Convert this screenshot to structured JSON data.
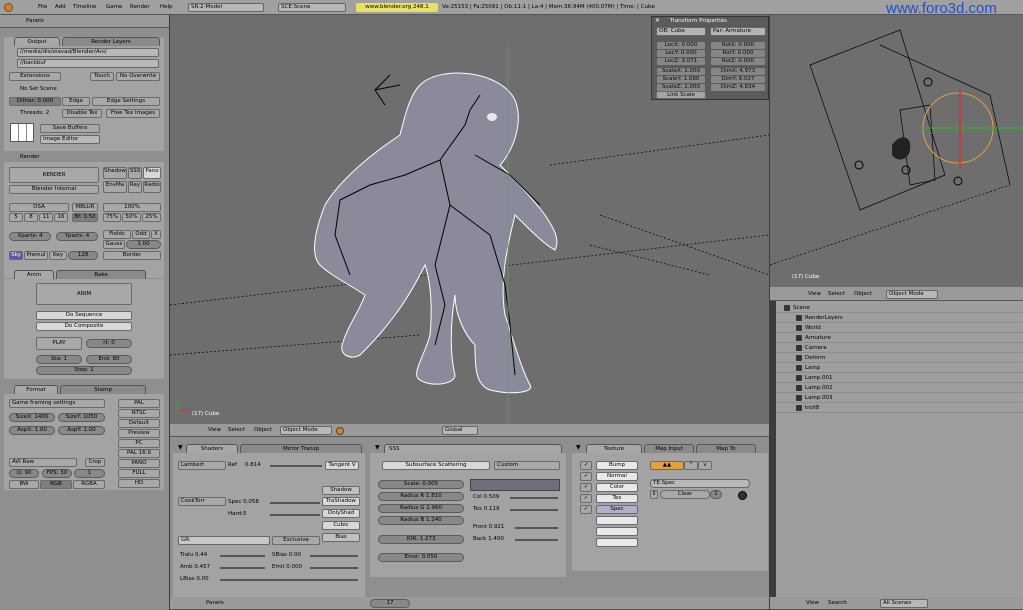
{
  "top_menu": {
    "items": [
      "File",
      "Add",
      "Timeline",
      "Game",
      "Render",
      "Help"
    ],
    "screen": "SR:2-Model",
    "scene": "SCE:Scene",
    "url": "www.blender.org 248.1",
    "stats": "Ve:25153 | Fa:25091 | Ob:11-1 | La:4 | Mem:36.94M (400.07M) | Time: | Cube"
  },
  "watermark": "www.foro3d.com",
  "left": {
    "panels_label": "Panels",
    "output_tab": "Output",
    "renderlayers_tab": "Render Layers",
    "path1": "//media/dis/stavad/Blender/Ani/",
    "path2": "//backbuf",
    "extensions": "Extensions",
    "touch": "Touch",
    "no_overwrite": "No Overwrite",
    "no_set_scene": "No Set Scene",
    "dither": "Dither: 0.000",
    "edge": "Edge",
    "edge_settings": "Edge Settings",
    "threads": "Threads: 2",
    "disable_tex": "Disable Tex",
    "free_tex": "Free Tex Images",
    "save_buffers": "Save Buffers",
    "image_editor": "Image Editor",
    "render_hdr": "Render",
    "render_btn": "RENDER",
    "blender_internal": "Blender Internal",
    "shadow": "Shadow",
    "sss": "SSS",
    "pano": "Pano",
    "envmap": "EnvMa",
    "ray": "Ray",
    "radio": "Radio",
    "osa": "OSA",
    "mblur": "MBLUR",
    "osa_vals": [
      "5",
      "8",
      "11",
      "16"
    ],
    "bf": "Bf: 0.50",
    "pct": [
      "100%",
      "75%",
      "50%",
      "25%"
    ],
    "xparts": "Xparts: 4",
    "yparts": "Yparts: 4",
    "fields": "Fields",
    "odd": "Odd",
    "x": "X",
    "gauss": "Gauss",
    "gauss_val": "1.00",
    "sky": "Sky",
    "premul": "Premul",
    "key": "Key",
    "val128": "128",
    "border": "Border",
    "anim_tab": "Anim",
    "bake_tab": "Bake",
    "anim_btn": "ANIM",
    "do_sequence": "Do Sequence",
    "do_composite": "Do Composite",
    "play": "PLAY",
    "rt": "rt: 0",
    "sta": "Sta: 1",
    "end": "End: 80",
    "step": "Step: 1",
    "format_tab": "Format",
    "stamp_tab": "Stamp",
    "game_framing": "Game framing settings",
    "sizex": "SizeX: 1400",
    "sizey": "SizeY: 1050",
    "aspx": "AspX: 1.00",
    "aspy": "AspY: 1.00",
    "presets": [
      "PAL",
      "NTSC",
      "Default",
      "Preview",
      "PC",
      "PAL 16:9",
      "PANO",
      "FULL",
      "HD"
    ],
    "avi_raw": "AVI Raw",
    "crop": "Crop",
    "q": "Q: 90",
    "fps": "FPS: 30",
    "val1": "1",
    "bw": "BW",
    "rgb": "RGB",
    "rgba": "RGBA"
  },
  "viewport": {
    "label": "(17) Cube",
    "menu": [
      "View",
      "Select",
      "Object"
    ],
    "mode": "Object Mode",
    "global": "Global"
  },
  "transform": {
    "title": "Transform Properties",
    "ob": "OB: Cube",
    "par": "Par: Armature",
    "loc": [
      "LocX: 0.000",
      "LocY: 0.000",
      "LocZ: 3.071"
    ],
    "rot": [
      "RotX: 0.000",
      "RotY: 0.000",
      "RotZ: 0.000"
    ],
    "scale": [
      "ScaleX: 1.000",
      "ScaleY: 1.090",
      "ScaleZ: 1.000"
    ],
    "dim": [
      "DimX: 4.973",
      "DimY: 6.027",
      "DimZ: 4.834"
    ],
    "link_scale": "Link Scale"
  },
  "camview": {
    "label": "(17) Cube",
    "menu": [
      "View",
      "Select",
      "Object"
    ],
    "mode": "Object Mode"
  },
  "outliner": {
    "items": [
      {
        "name": "Scene",
        "indent": 0
      },
      {
        "name": "RenderLayers",
        "indent": 1
      },
      {
        "name": "World",
        "indent": 1
      },
      {
        "name": "Armature",
        "indent": 1
      },
      {
        "name": "Camera",
        "indent": 1
      },
      {
        "name": "Deform",
        "indent": 1
      },
      {
        "name": "Lamp",
        "indent": 1
      },
      {
        "name": "Lamp.001",
        "indent": 1
      },
      {
        "name": "Lamp.002",
        "indent": 1
      },
      {
        "name": "Lamp.003",
        "indent": 1
      },
      {
        "name": "troll8",
        "indent": 1
      }
    ],
    "footer": [
      "View",
      "Search"
    ],
    "all_scenes": "All Scenes"
  },
  "shaders": {
    "tab1": "Shaders",
    "tab2": "Mirror Transp",
    "lambert": "Lambert",
    "ref": "Ref",
    "ref_val": "0.814",
    "tangent": "Tangent V",
    "cooktorr": "CookTorr",
    "spec": "Spec 0.058",
    "hard": "Hard:5",
    "shadow": "Shadow",
    "trashadow": "TraShadow",
    "onlyshad": "OnlyShad",
    "cubic": "Cubic",
    "bias": "Bias",
    "gr": "GR:",
    "exclusive": "Exclusive",
    "tralu": "Tralu 0.44",
    "sbias": "SBias 0.00",
    "amb": "Amb 0.457",
    "emit": "Emit 0.000",
    "lbias": "LBias 0.00"
  },
  "sss": {
    "tab": "SSS",
    "subsurface": "Subsurface Scattering",
    "custom": "Custom",
    "scale": "Scale: 0.005",
    "radius_r": "Radius R 1.810",
    "radius_g": "Radius G 1.960",
    "radius_b": "Radius B 1.240",
    "col": "Col 0.509",
    "tex": "Tex 0.119",
    "ior": "IOR: 1.273",
    "front": "Front 0.921",
    "back": "Back 1.400",
    "error": "Error: 0.050"
  },
  "texture": {
    "tab1": "Texture",
    "tab2": "Map Input",
    "tab3": "Map To",
    "channels": [
      "Bump",
      "Normal",
      "Color",
      "Tex",
      "Spec"
    ],
    "te": "TE:Spec",
    "clear": "Clear",
    "one": "1"
  },
  "bottom": {
    "panels": "Panels",
    "frame": "17"
  },
  "colors": {
    "viewport_bg": "#6e6e6e",
    "x_axis": "#d03030",
    "y_axis": "#30b030",
    "lamp_ring": "#e0a040"
  }
}
